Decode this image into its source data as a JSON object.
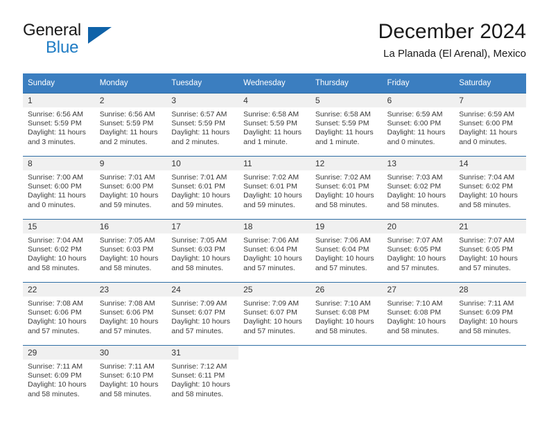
{
  "brand": {
    "name_part1": "General",
    "name_part2": "Blue",
    "logo_icon": "blue-triangle-logo"
  },
  "header": {
    "title": "December 2024",
    "location": "La Planada (El Arenal), Mexico"
  },
  "calendar": {
    "weekday_headers": [
      "Sunday",
      "Monday",
      "Tuesday",
      "Wednesday",
      "Thursday",
      "Friday",
      "Saturday"
    ],
    "accent_color": "#3b7ec0",
    "daynum_bg_color": "#f0f0f0",
    "grid_line_color": "#2e6da4",
    "weeks": [
      [
        {
          "day": "1",
          "sunrise": "Sunrise: 6:56 AM",
          "sunset": "Sunset: 5:59 PM",
          "daylight_line1": "Daylight: 11 hours",
          "daylight_line2": "and 3 minutes."
        },
        {
          "day": "2",
          "sunrise": "Sunrise: 6:56 AM",
          "sunset": "Sunset: 5:59 PM",
          "daylight_line1": "Daylight: 11 hours",
          "daylight_line2": "and 2 minutes."
        },
        {
          "day": "3",
          "sunrise": "Sunrise: 6:57 AM",
          "sunset": "Sunset: 5:59 PM",
          "daylight_line1": "Daylight: 11 hours",
          "daylight_line2": "and 2 minutes."
        },
        {
          "day": "4",
          "sunrise": "Sunrise: 6:58 AM",
          "sunset": "Sunset: 5:59 PM",
          "daylight_line1": "Daylight: 11 hours",
          "daylight_line2": "and 1 minute."
        },
        {
          "day": "5",
          "sunrise": "Sunrise: 6:58 AM",
          "sunset": "Sunset: 5:59 PM",
          "daylight_line1": "Daylight: 11 hours",
          "daylight_line2": "and 1 minute."
        },
        {
          "day": "6",
          "sunrise": "Sunrise: 6:59 AM",
          "sunset": "Sunset: 6:00 PM",
          "daylight_line1": "Daylight: 11 hours",
          "daylight_line2": "and 0 minutes."
        },
        {
          "day": "7",
          "sunrise": "Sunrise: 6:59 AM",
          "sunset": "Sunset: 6:00 PM",
          "daylight_line1": "Daylight: 11 hours",
          "daylight_line2": "and 0 minutes."
        }
      ],
      [
        {
          "day": "8",
          "sunrise": "Sunrise: 7:00 AM",
          "sunset": "Sunset: 6:00 PM",
          "daylight_line1": "Daylight: 11 hours",
          "daylight_line2": "and 0 minutes."
        },
        {
          "day": "9",
          "sunrise": "Sunrise: 7:01 AM",
          "sunset": "Sunset: 6:00 PM",
          "daylight_line1": "Daylight: 10 hours",
          "daylight_line2": "and 59 minutes."
        },
        {
          "day": "10",
          "sunrise": "Sunrise: 7:01 AM",
          "sunset": "Sunset: 6:01 PM",
          "daylight_line1": "Daylight: 10 hours",
          "daylight_line2": "and 59 minutes."
        },
        {
          "day": "11",
          "sunrise": "Sunrise: 7:02 AM",
          "sunset": "Sunset: 6:01 PM",
          "daylight_line1": "Daylight: 10 hours",
          "daylight_line2": "and 59 minutes."
        },
        {
          "day": "12",
          "sunrise": "Sunrise: 7:02 AM",
          "sunset": "Sunset: 6:01 PM",
          "daylight_line1": "Daylight: 10 hours",
          "daylight_line2": "and 58 minutes."
        },
        {
          "day": "13",
          "sunrise": "Sunrise: 7:03 AM",
          "sunset": "Sunset: 6:02 PM",
          "daylight_line1": "Daylight: 10 hours",
          "daylight_line2": "and 58 minutes."
        },
        {
          "day": "14",
          "sunrise": "Sunrise: 7:04 AM",
          "sunset": "Sunset: 6:02 PM",
          "daylight_line1": "Daylight: 10 hours",
          "daylight_line2": "and 58 minutes."
        }
      ],
      [
        {
          "day": "15",
          "sunrise": "Sunrise: 7:04 AM",
          "sunset": "Sunset: 6:02 PM",
          "daylight_line1": "Daylight: 10 hours",
          "daylight_line2": "and 58 minutes."
        },
        {
          "day": "16",
          "sunrise": "Sunrise: 7:05 AM",
          "sunset": "Sunset: 6:03 PM",
          "daylight_line1": "Daylight: 10 hours",
          "daylight_line2": "and 58 minutes."
        },
        {
          "day": "17",
          "sunrise": "Sunrise: 7:05 AM",
          "sunset": "Sunset: 6:03 PM",
          "daylight_line1": "Daylight: 10 hours",
          "daylight_line2": "and 58 minutes."
        },
        {
          "day": "18",
          "sunrise": "Sunrise: 7:06 AM",
          "sunset": "Sunset: 6:04 PM",
          "daylight_line1": "Daylight: 10 hours",
          "daylight_line2": "and 57 minutes."
        },
        {
          "day": "19",
          "sunrise": "Sunrise: 7:06 AM",
          "sunset": "Sunset: 6:04 PM",
          "daylight_line1": "Daylight: 10 hours",
          "daylight_line2": "and 57 minutes."
        },
        {
          "day": "20",
          "sunrise": "Sunrise: 7:07 AM",
          "sunset": "Sunset: 6:05 PM",
          "daylight_line1": "Daylight: 10 hours",
          "daylight_line2": "and 57 minutes."
        },
        {
          "day": "21",
          "sunrise": "Sunrise: 7:07 AM",
          "sunset": "Sunset: 6:05 PM",
          "daylight_line1": "Daylight: 10 hours",
          "daylight_line2": "and 57 minutes."
        }
      ],
      [
        {
          "day": "22",
          "sunrise": "Sunrise: 7:08 AM",
          "sunset": "Sunset: 6:06 PM",
          "daylight_line1": "Daylight: 10 hours",
          "daylight_line2": "and 57 minutes."
        },
        {
          "day": "23",
          "sunrise": "Sunrise: 7:08 AM",
          "sunset": "Sunset: 6:06 PM",
          "daylight_line1": "Daylight: 10 hours",
          "daylight_line2": "and 57 minutes."
        },
        {
          "day": "24",
          "sunrise": "Sunrise: 7:09 AM",
          "sunset": "Sunset: 6:07 PM",
          "daylight_line1": "Daylight: 10 hours",
          "daylight_line2": "and 57 minutes."
        },
        {
          "day": "25",
          "sunrise": "Sunrise: 7:09 AM",
          "sunset": "Sunset: 6:07 PM",
          "daylight_line1": "Daylight: 10 hours",
          "daylight_line2": "and 57 minutes."
        },
        {
          "day": "26",
          "sunrise": "Sunrise: 7:10 AM",
          "sunset": "Sunset: 6:08 PM",
          "daylight_line1": "Daylight: 10 hours",
          "daylight_line2": "and 58 minutes."
        },
        {
          "day": "27",
          "sunrise": "Sunrise: 7:10 AM",
          "sunset": "Sunset: 6:08 PM",
          "daylight_line1": "Daylight: 10 hours",
          "daylight_line2": "and 58 minutes."
        },
        {
          "day": "28",
          "sunrise": "Sunrise: 7:11 AM",
          "sunset": "Sunset: 6:09 PM",
          "daylight_line1": "Daylight: 10 hours",
          "daylight_line2": "and 58 minutes."
        }
      ],
      [
        {
          "day": "29",
          "sunrise": "Sunrise: 7:11 AM",
          "sunset": "Sunset: 6:09 PM",
          "daylight_line1": "Daylight: 10 hours",
          "daylight_line2": "and 58 minutes."
        },
        {
          "day": "30",
          "sunrise": "Sunrise: 7:11 AM",
          "sunset": "Sunset: 6:10 PM",
          "daylight_line1": "Daylight: 10 hours",
          "daylight_line2": "and 58 minutes."
        },
        {
          "day": "31",
          "sunrise": "Sunrise: 7:12 AM",
          "sunset": "Sunset: 6:11 PM",
          "daylight_line1": "Daylight: 10 hours",
          "daylight_line2": "and 58 minutes."
        },
        {
          "day": "",
          "sunrise": "",
          "sunset": "",
          "daylight_line1": "",
          "daylight_line2": ""
        },
        {
          "day": "",
          "sunrise": "",
          "sunset": "",
          "daylight_line1": "",
          "daylight_line2": ""
        },
        {
          "day": "",
          "sunrise": "",
          "sunset": "",
          "daylight_line1": "",
          "daylight_line2": ""
        },
        {
          "day": "",
          "sunrise": "",
          "sunset": "",
          "daylight_line1": "",
          "daylight_line2": ""
        }
      ]
    ]
  }
}
